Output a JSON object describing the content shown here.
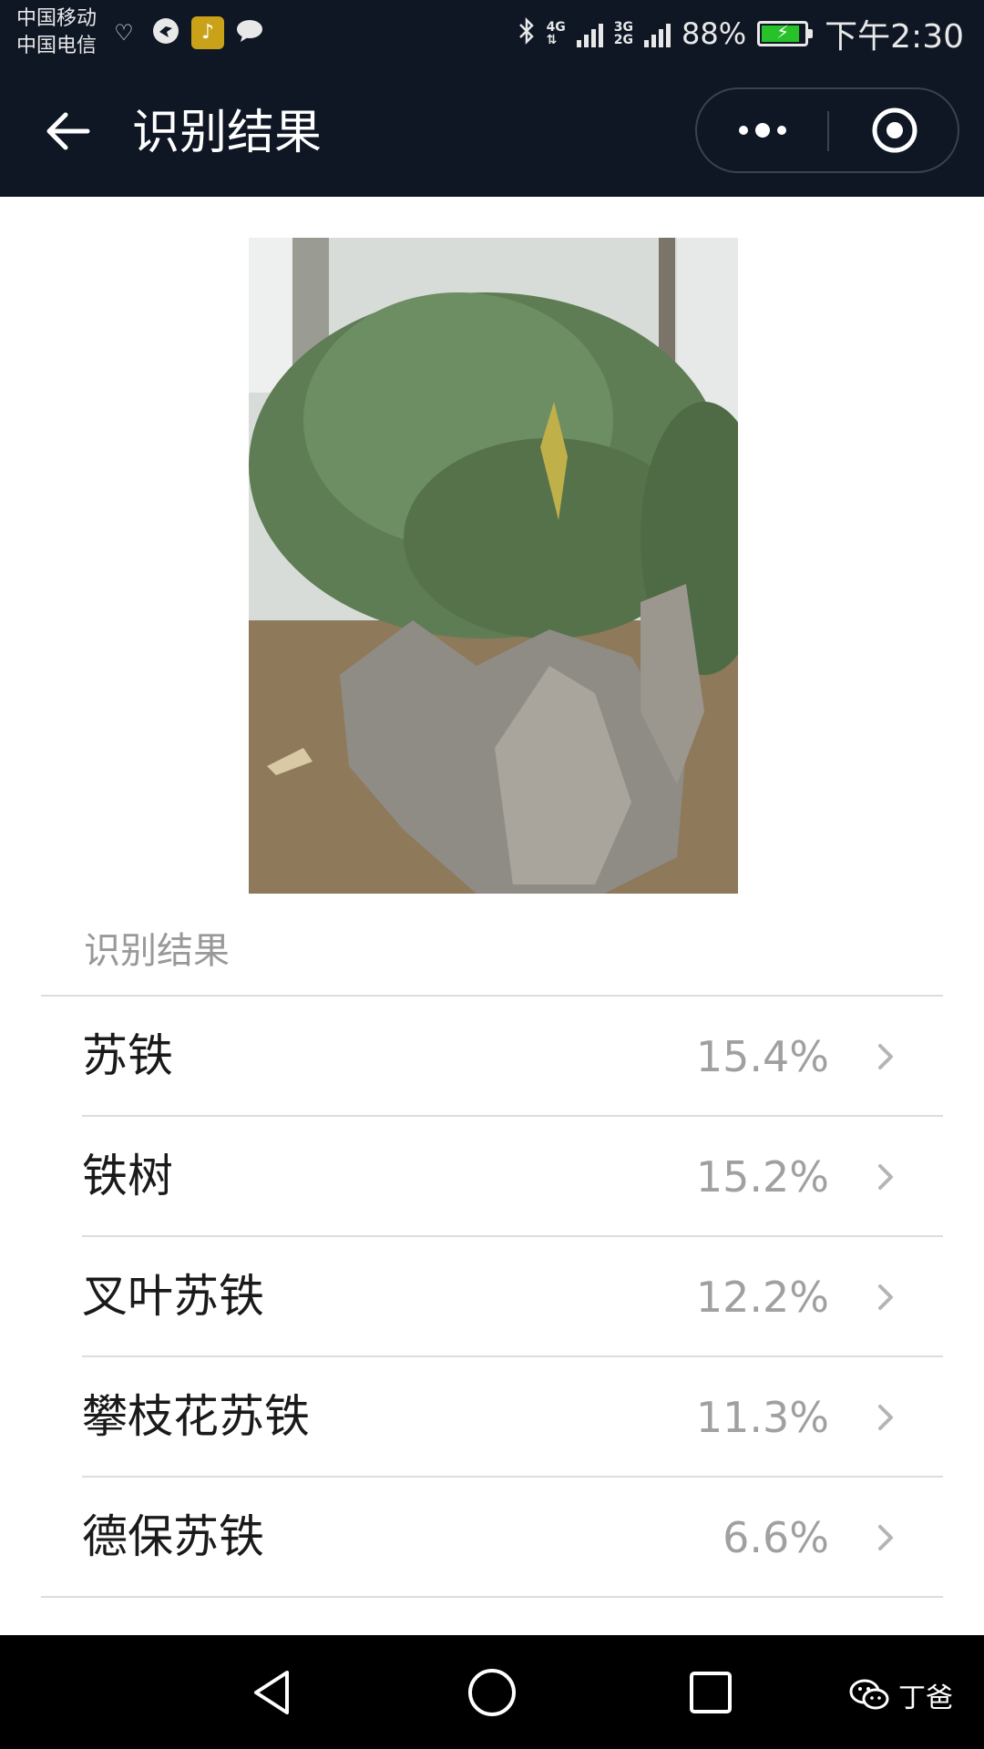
{
  "status_bar": {
    "carrier_1": "中国移动",
    "carrier_2": "中国电信",
    "network_1": "4G",
    "network_2": "3G",
    "network_3": "2G",
    "battery_percent": "88%",
    "battery_level": 0.88,
    "time": "下午2:30",
    "icons": [
      "heart-rate-icon",
      "bird-app-icon",
      "music-app-icon",
      "chat-bubble-icon",
      "bluetooth-icon",
      "signal-icon",
      "battery-charging-icon"
    ]
  },
  "nav": {
    "title": "识别结果",
    "icons": [
      "back-arrow-icon",
      "more-dots-icon",
      "close-target-icon"
    ]
  },
  "results": {
    "section_title": "识别结果",
    "items": [
      {
        "name": "苏铁",
        "percent": "15.4%"
      },
      {
        "name": "铁树",
        "percent": "15.2%"
      },
      {
        "name": "叉叶苏铁",
        "percent": "12.2%"
      },
      {
        "name": "攀枝花苏铁",
        "percent": "11.3%"
      },
      {
        "name": "德保苏铁",
        "percent": "6.6%"
      }
    ]
  },
  "system_nav": {
    "icons": [
      "back-triangle-icon",
      "home-circle-icon",
      "recents-square-icon"
    ]
  },
  "watermark": {
    "text": "丁爸",
    "icon": "wechat-icon"
  },
  "colors": {
    "header_bg": "#0f1725",
    "text_primary": "#1a1a1a",
    "text_secondary": "#999999",
    "divider": "#dddddd",
    "battery_green": "#27c12a"
  }
}
